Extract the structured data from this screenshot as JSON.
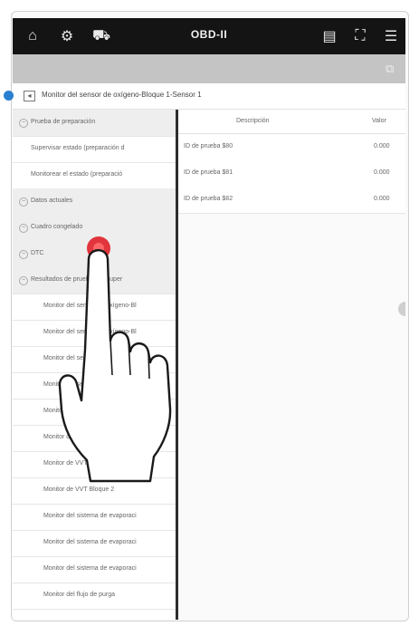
{
  "header": {
    "title": "OBD-II",
    "left_icons": [
      "home-icon",
      "settings-gear-icon",
      "vehicle-icon"
    ],
    "right_icons": [
      "print-icon",
      "fullscreen-icon",
      "menu-icon"
    ]
  },
  "subbar": {
    "icon": "export-icon"
  },
  "breadcrumb": {
    "text": "Monitor del sensor de oxígeno-Bloque 1-Sensor 1"
  },
  "tree": [
    {
      "kind": "cat",
      "label": "Prueba de preparación"
    },
    {
      "kind": "sub",
      "label": "Supervisar estado (preparación d"
    },
    {
      "kind": "sub",
      "label": "Monitorear el estado (preparació"
    },
    {
      "kind": "cat",
      "label": "Datos actuales"
    },
    {
      "kind": "cat",
      "label": "Cuadro congelado"
    },
    {
      "kind": "cat",
      "label": "DTC"
    },
    {
      "kind": "cat",
      "label": "Resultados de pruebas de super"
    },
    {
      "kind": "item",
      "label": "Monitor del sensor de oxígeno-Bl"
    },
    {
      "kind": "item",
      "label": "Monitor del sensor de oxígeno-Bl"
    },
    {
      "kind": "item",
      "label": "Monitor del sensor de oxígeno-Bl"
    },
    {
      "kind": "item",
      "label": "Monitor del sensor de oxígeno-Bl"
    },
    {
      "kind": "item",
      "label": "Monitor del catalizador-Bloque 1"
    },
    {
      "kind": "item",
      "label": "Monitor del catalizador-Bloque 2"
    },
    {
      "kind": "item",
      "label": "Monitor de VVT Bloque 1"
    },
    {
      "kind": "item",
      "label": "Monitor de VVT Bloque 2"
    },
    {
      "kind": "item",
      "label": "Monitor del sistema de evaporaci"
    },
    {
      "kind": "item",
      "label": "Monitor del sistema de evaporaci"
    },
    {
      "kind": "item",
      "label": "Monitor del sistema de evaporaci"
    },
    {
      "kind": "item",
      "label": "Monitor del flujo de purga"
    }
  ],
  "table": {
    "columns": [
      "Descripción",
      "Valor"
    ],
    "rows": [
      {
        "desc": "ID de prueba $80",
        "value": "0.000"
      },
      {
        "desc": "ID de prueba $81",
        "value": "0.000"
      },
      {
        "desc": "ID de prueba $82",
        "value": "0.000"
      }
    ]
  },
  "overlay": {
    "name": "tap-gesture-hand-icon",
    "color": "#e0242c"
  }
}
